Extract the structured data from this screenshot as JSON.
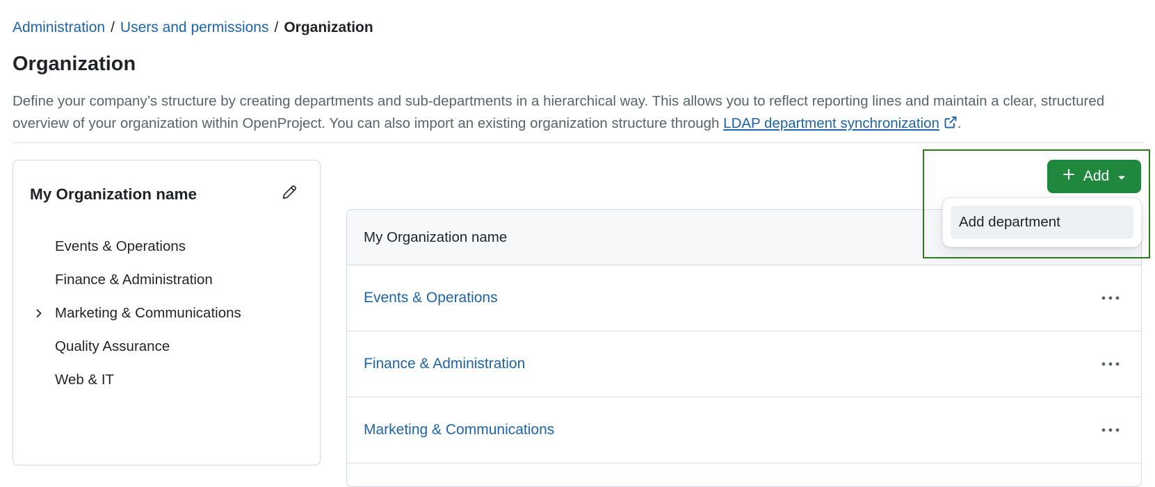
{
  "breadcrumb": {
    "items": [
      "Administration",
      "Users and permissions"
    ],
    "separator": "/",
    "current": "Organization"
  },
  "page": {
    "title": "Organization",
    "description_before": "Define your company’s structure by creating departments and sub-departments in a hierarchical way. This allows you to reflect reporting lines and maintain a clear, structured overview of your organization within OpenProject. You can also import an existing organization structure through ",
    "description_link": "LDAP department synchronization",
    "description_after": "."
  },
  "tree": {
    "title": "My Organization name",
    "edit_icon": "pencil-icon",
    "items": [
      {
        "label": "Events & Operations",
        "expandable": false
      },
      {
        "label": "Finance & Administration",
        "expandable": false
      },
      {
        "label": "Marketing & Communications",
        "expandable": true
      },
      {
        "label": "Quality Assurance",
        "expandable": false
      },
      {
        "label": "Web & IT",
        "expandable": false
      }
    ]
  },
  "table": {
    "header": "My Organization name",
    "rows": [
      {
        "name": "Events & Operations"
      },
      {
        "name": "Finance & Administration"
      },
      {
        "name": "Marketing & Communications"
      }
    ]
  },
  "toolbar": {
    "add_label": "Add",
    "add_icon": "plus-icon",
    "caret_icon": "triangle-down-icon"
  },
  "add_menu": {
    "items": [
      "Add department"
    ]
  },
  "colors": {
    "link": "#1c63a7",
    "primary_button": "#1f883d",
    "highlight_border": "#2d7a1a",
    "muted_text": "#59636e"
  }
}
